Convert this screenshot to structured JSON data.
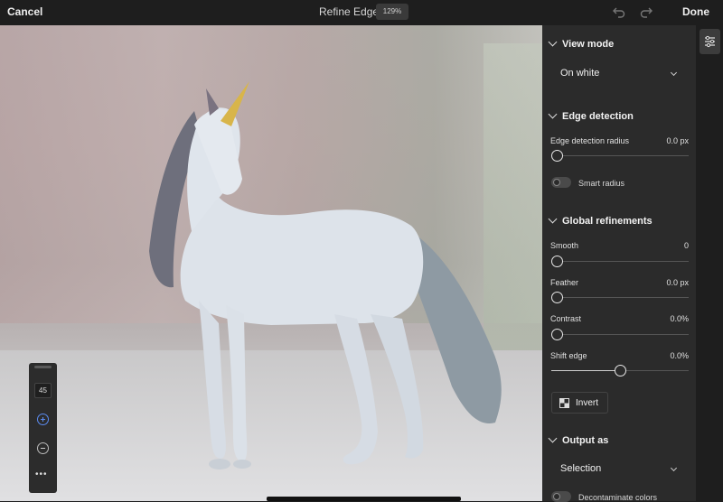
{
  "topbar": {
    "cancel_label": "Cancel",
    "title": "Refine Edge",
    "zoom": "129%",
    "done_label": "Done"
  },
  "brush_toolbar": {
    "size": "45",
    "more_label": "•••"
  },
  "panel": {
    "view_mode": {
      "heading": "View mode",
      "selected": "On white"
    },
    "edge_detection": {
      "heading": "Edge detection",
      "radius_label": "Edge detection radius",
      "radius_value": "0.0 px",
      "radius_fraction": 0,
      "smart_radius_label": "Smart radius",
      "smart_radius_on": false
    },
    "global_refinements": {
      "heading": "Global refinements",
      "smooth_label": "Smooth",
      "smooth_value": "0",
      "feather_label": "Feather",
      "feather_value": "0.0 px",
      "contrast_label": "Contrast",
      "contrast_value": "0.0%",
      "shift_edge_label": "Shift edge",
      "shift_edge_value": "0.0%",
      "shift_edge_fraction": 0.5,
      "invert_label": "Invert"
    },
    "output_as": {
      "heading": "Output as",
      "selected": "Selection",
      "decontaminate_label": "Decontaminate colors"
    }
  },
  "colors": {
    "panel_bg": "#2b2b2b",
    "topbar_bg": "#1e1e1e",
    "accent_blue": "#5b8bf0"
  }
}
